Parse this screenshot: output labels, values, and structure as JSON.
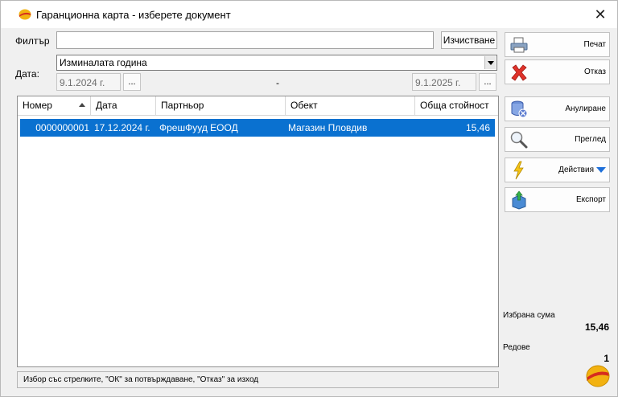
{
  "window": {
    "title": "Гаранционна карта - изберете документ",
    "close_glyph": "✕"
  },
  "filter": {
    "label": "Филтър",
    "value": "",
    "clear_button": "Изчистване"
  },
  "date": {
    "label": "Дата:",
    "period": "Изминалата година",
    "from": "9.1.2024 г.",
    "to": "9.1.2025 г.",
    "separator": "-",
    "picker_label": "..."
  },
  "grid": {
    "columns": [
      "Номер",
      "Дата",
      "Партньор",
      "Обект",
      "Обща стойност"
    ],
    "rows": [
      {
        "number": "0000000001",
        "date": "17.12.2024 г.",
        "partner": "ФрешФууд ЕООД",
        "object": "Магазин Пловдив",
        "total": "15,46"
      }
    ]
  },
  "status_text": "Избор със стрелките, \"ОК\" за потвърждаване, \"Отказ\" за изход",
  "actions": {
    "print": "Печат",
    "cancel": "Отказ",
    "annul": "Анулиране",
    "preview": "Преглед",
    "actions": "Действия",
    "export": "Експорт"
  },
  "summary": {
    "sum_label": "Избрана сума",
    "sum_value": "15,46",
    "rows_label": "Редове",
    "rows_value": "1"
  },
  "colors": {
    "selection": "#0a71d0",
    "accent_arrow": "#1e6fd9",
    "cancel_icon": "#e0322a"
  }
}
